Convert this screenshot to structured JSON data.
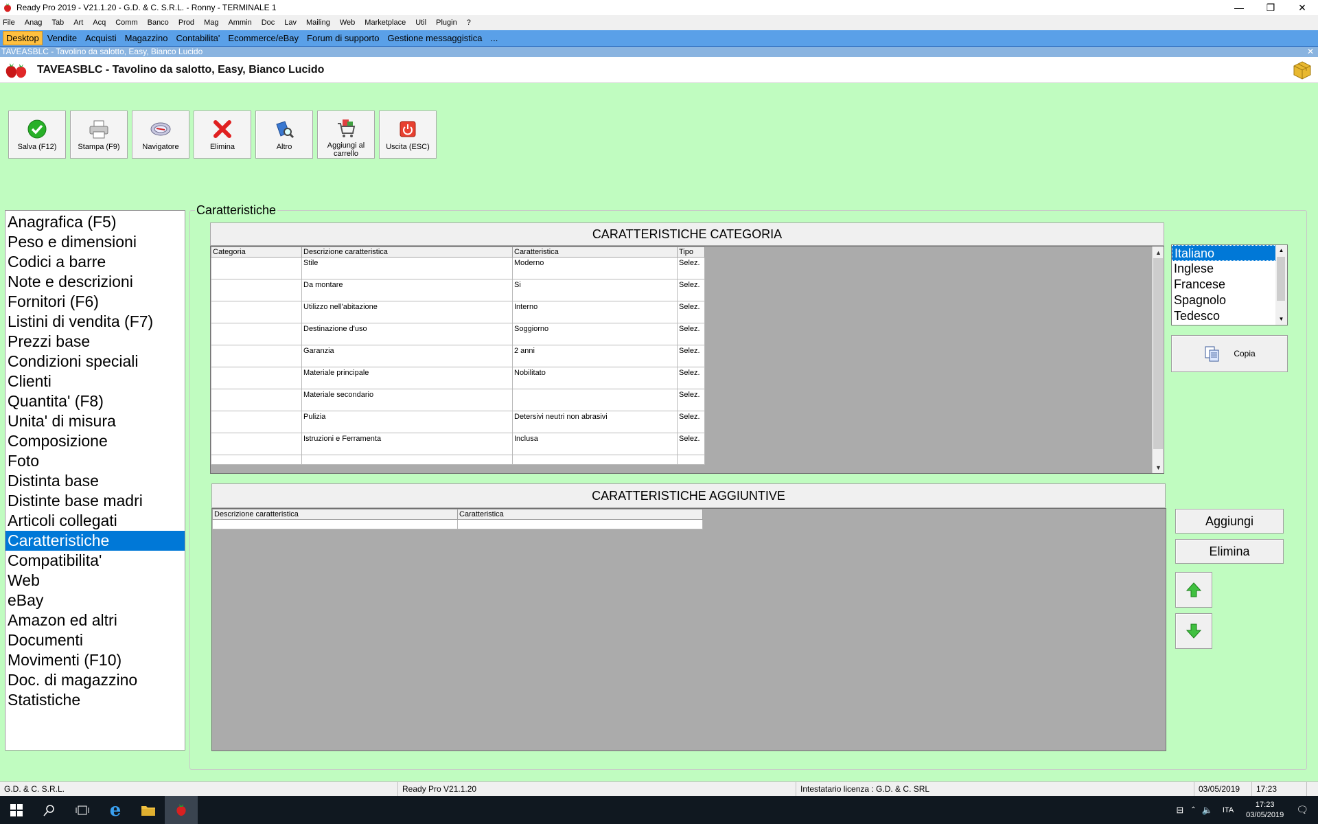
{
  "window": {
    "title": "Ready Pro 2019 - V21.1.20 - G.D. & C. S.R.L. - Ronny - TERMINALE 1",
    "minimize": "—",
    "restore": "❐",
    "close": "✕"
  },
  "menu": [
    "File",
    "Anag",
    "Tab",
    "Art",
    "Acq",
    "Comm",
    "Banco",
    "Prod",
    "Mag",
    "Ammin",
    "Doc",
    "Lav",
    "Mailing",
    "Web",
    "Marketplace",
    "Util",
    "Plugin",
    "?"
  ],
  "tabs": [
    "Desktop",
    "Vendite",
    "Acquisti",
    "Magazzino",
    "Contabilita'",
    "Ecommerce/eBay",
    "Forum di supporto",
    "Gestione messaggistica",
    "..."
  ],
  "active_tab": "Desktop",
  "strip_title": "TAVEASBLC - Tavolino da salotto, Easy, Bianco Lucido",
  "header_title": "TAVEASBLC - Tavolino da salotto, Easy, Bianco Lucido",
  "toolbar": {
    "save": "Salva (F12)",
    "print": "Stampa (F9)",
    "navigator": "Navigatore",
    "delete": "Elimina",
    "other": "Altro",
    "cart": "Aggiungi al carrello",
    "exit": "Uscita (ESC)"
  },
  "nav": [
    "Anagrafica (F5)",
    "Peso e dimensioni",
    "Codici a barre",
    "Note e descrizioni",
    "Fornitori (F6)",
    "Listini di vendita (F7)",
    "Prezzi base",
    "Condizioni speciali",
    "Clienti",
    "Quantita' (F8)",
    "Unita' di misura",
    "Composizione",
    "Foto",
    "Distinta base",
    "Distinte base madri",
    "Articoli collegati",
    "Caratteristiche",
    "Compatibilita'",
    "Web",
    "eBay",
    "Amazon ed altri",
    "Documenti",
    "Movimenti (F10)",
    "Doc. di magazzino",
    "Statistiche"
  ],
  "nav_selected": "Caratteristiche",
  "group_title": "Caratteristiche",
  "cat": {
    "title": "CARATTERISTICHE CATEGORIA",
    "columns": [
      "Categoria",
      "Descrizione caratteristica",
      "Caratteristica",
      "Tipo"
    ],
    "rows": [
      [
        "",
        "Stile",
        "Moderno",
        "Selez."
      ],
      [
        "",
        "Da montare",
        "Si",
        "Selez."
      ],
      [
        "",
        "Utilizzo nell'abitazione",
        "Interno",
        "Selez."
      ],
      [
        "",
        "Destinazione d'uso",
        "Soggiorno",
        "Selez."
      ],
      [
        "",
        "Garanzia",
        "2 anni",
        "Selez."
      ],
      [
        "",
        "Materiale principale",
        "Nobilitato",
        "Selez."
      ],
      [
        "",
        "Materiale secondario",
        "",
        "Selez."
      ],
      [
        "",
        "Pulizia",
        "Detersivi neutri non abrasivi",
        "Selez."
      ],
      [
        "",
        "Istruzioni e Ferramenta",
        "Inclusa",
        "Selez."
      ]
    ]
  },
  "languages": [
    "Italiano",
    "Inglese",
    "Francese",
    "Spagnolo",
    "Tedesco"
  ],
  "language_selected": "Italiano",
  "copy_button": "Copia",
  "add": {
    "title": "CARATTERISTICHE AGGIUNTIVE",
    "columns": [
      "Descrizione caratteristica",
      "Caratteristica"
    ],
    "add_button": "Aggiungi",
    "delete_button": "Elimina"
  },
  "status": {
    "company": "G.D. & C. S.R.L.",
    "version": "Ready Pro V21.1.20",
    "license": "Intestatario licenza : G.D. & C. SRL",
    "date": "03/05/2019",
    "time": "17:23"
  },
  "taskbar": {
    "lang": "ITA",
    "time": "17:23",
    "date": "03/05/2019"
  },
  "colors": {
    "background": "#c0fcc0",
    "selection": "#0078d7",
    "tabbar": "#5aa0e8",
    "active_tab": "#ffc040",
    "grid_empty": "#ababab"
  }
}
